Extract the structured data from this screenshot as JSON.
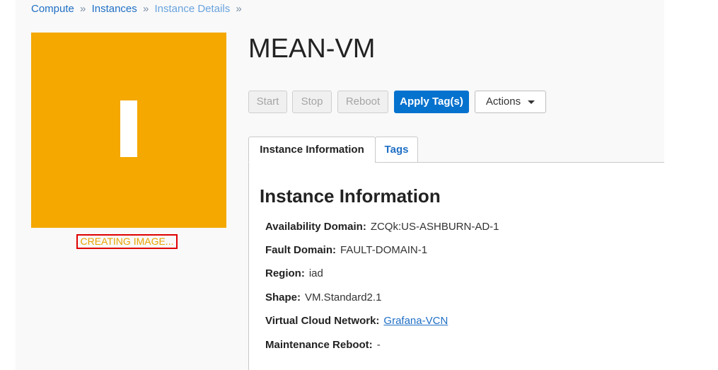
{
  "breadcrumb": {
    "items": [
      "Compute",
      "Instances",
      "Instance Details"
    ],
    "separator": "»"
  },
  "instance": {
    "name": "MEAN-VM",
    "icon_color": "#f4a800",
    "status": "CREATING IMAGE..."
  },
  "toolbar": {
    "start_label": "Start",
    "stop_label": "Stop",
    "reboot_label": "Reboot",
    "apply_tags_label": "Apply Tag(s)",
    "actions_label": "Actions"
  },
  "tabs": [
    {
      "label": "Instance Information",
      "active": true
    },
    {
      "label": "Tags",
      "active": false
    }
  ],
  "info": {
    "title": "Instance Information",
    "fields": [
      {
        "label": "Availability Domain:",
        "value": "ZCQk:US-ASHBURN-AD-1"
      },
      {
        "label": "Fault Domain:",
        "value": "FAULT-DOMAIN-1"
      },
      {
        "label": "Region:",
        "value": "iad"
      },
      {
        "label": "Shape:",
        "value": "VM.Standard2.1"
      },
      {
        "label": "Virtual Cloud Network:",
        "value": "Grafana-VCN"
      },
      {
        "label": "Maintenance Reboot:",
        "value": "-"
      }
    ]
  }
}
